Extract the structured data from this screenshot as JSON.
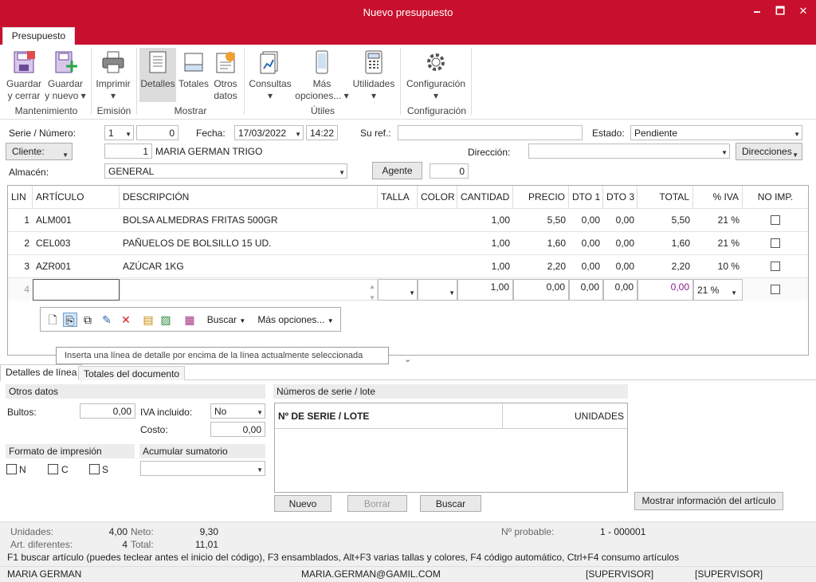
{
  "window": {
    "title": "Nuevo presupuesto",
    "minimize": "🗕",
    "maximize": "🗖",
    "close": "✕"
  },
  "ribbon": {
    "tab": "Presupuesto",
    "buttons": {
      "guardar_cerrar": [
        "Guardar",
        "y cerrar"
      ],
      "guardar_nuevo": [
        "Guardar",
        "y nuevo ▾"
      ],
      "imprimir": [
        "Imprimir",
        "▾"
      ],
      "detalles": "Detalles",
      "totales": "Totales",
      "otros_datos": [
        "Otros",
        "datos"
      ],
      "consultas": [
        "Consultas",
        "▾"
      ],
      "mas_opciones": [
        "Más",
        "opciones... ▾"
      ],
      "utilidades": [
        "Utilidades",
        "▾"
      ],
      "configuracion": [
        "Configuración",
        "▾"
      ]
    },
    "groups": {
      "mantenimiento": "Mantenimiento",
      "emision": "Emisión",
      "mostrar": "Mostrar",
      "utiles": "Útiles",
      "configuracion": "Configuración"
    }
  },
  "header": {
    "serie_label": "Serie / Número:",
    "serie": "1",
    "numero": "0",
    "fecha_label": "Fecha:",
    "fecha": "17/03/2022",
    "hora": "14:22",
    "su_ref_label": "Su ref.:",
    "su_ref": "",
    "estado_label": "Estado:",
    "estado": "Pendiente",
    "cliente_btn": "Cliente:",
    "cliente_num": "1",
    "cliente_nombre": "MARIA GERMAN TRIGO",
    "direccion_label": "Dirección:",
    "direccion": "",
    "direcciones_btn": "Direcciones",
    "almacen_label": "Almacén:",
    "almacen": "GENERAL",
    "agente_btn": "Agente",
    "agente": "0"
  },
  "grid": {
    "columns": [
      "LIN",
      "ARTÍCULO",
      "DESCRIPCIÓN",
      "TALLA",
      "COLOR",
      "CANTIDAD",
      "PRECIO",
      "DTO 1",
      "DTO 3",
      "TOTAL",
      "% IVA",
      "NO IMP."
    ],
    "rows": [
      {
        "lin": "1",
        "articulo": "ALM001",
        "descripcion": "BOLSA ALMEDRAS FRITAS 500GR",
        "cantidad": "1,00",
        "precio": "5,50",
        "dto1": "0,00",
        "dto3": "0,00",
        "total": "5,50",
        "iva": "21 %"
      },
      {
        "lin": "2",
        "articulo": "CEL003",
        "descripcion": "PAÑUELOS DE BOLSILLO 15 UD.",
        "cantidad": "1,00",
        "precio": "1,60",
        "dto1": "0,00",
        "dto3": "0,00",
        "total": "1,60",
        "iva": "21 %"
      },
      {
        "lin": "3",
        "articulo": "AZR001",
        "descripcion": "AZÚCAR 1KG",
        "cantidad": "1,00",
        "precio": "2,20",
        "dto1": "0,00",
        "dto3": "0,00",
        "total": "2,20",
        "iva": "10 %"
      }
    ],
    "new_row": {
      "lin": "4",
      "cantidad": "1,00",
      "precio": "0,00",
      "dto1": "0,00",
      "dto3": "0,00",
      "total": "0,00",
      "iva": "21 %"
    },
    "toolbar": {
      "buscar": "Buscar",
      "mas_opciones": "Más opciones..."
    },
    "tooltip": "Inserta una línea de detalle por encima de la línea actualmente seleccionada"
  },
  "bottom_tabs": [
    "Detalles de línea",
    "Totales del documento"
  ],
  "otros_datos": {
    "title": "Otros datos",
    "bultos_label": "Bultos:",
    "bultos": "0,00",
    "iva_incluido_label": "IVA incluido:",
    "iva_incluido": "No",
    "costo_label": "Costo:",
    "costo": "0,00"
  },
  "formato": {
    "title": "Formato de impresión",
    "opts": [
      "N",
      "C",
      "S"
    ]
  },
  "acumular": {
    "title": "Acumular sumatorio",
    "value": ""
  },
  "series": {
    "title": "Números de serie / lote",
    "col1": "Nº DE SERIE / LOTE",
    "col2": "UNIDADES",
    "nuevo": "Nuevo",
    "borrar": "Borrar",
    "buscar": "Buscar",
    "mostrar_info": "Mostrar información del artículo"
  },
  "status": {
    "unidades_label": "Unidades:",
    "unidades": "4,00",
    "neto_label": "Neto:",
    "neto": "9,30",
    "art_dif_label": "Art. diferentes:",
    "art_dif": "4",
    "total_label": "Total:",
    "total": "11,01",
    "probable_label": "Nº probable:",
    "probable": "1 - 000001",
    "help": "F1 buscar artículo (puedes teclear antes el inicio del código), F3 ensamblados, Alt+F3 varias tallas y colores, F4 código automático, Ctrl+F4 consumo artículos",
    "user": "MARIA GERMAN",
    "email": "MARIA.GERMAN@GAMIL.COM",
    "role1": "[SUPERVISOR]",
    "role2": "[SUPERVISOR]"
  },
  "colors": {
    "accent": "#c8102e",
    "purple_total": "#8b1a8b"
  }
}
